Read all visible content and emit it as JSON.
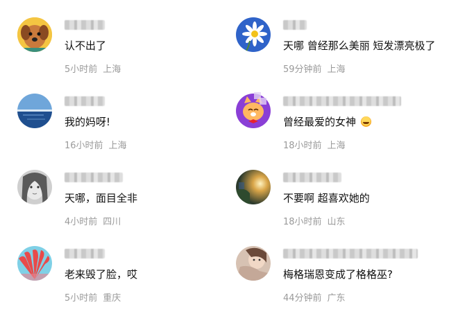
{
  "comments": [
    {
      "text": "认不出了",
      "time": "5小时前",
      "location": "上海",
      "avatar": "dog-avatar"
    },
    {
      "text": "天哪 曾经那么美丽 短发漂亮极了",
      "time": "59分钟前",
      "location": "上海",
      "avatar": "daisy-avatar"
    },
    {
      "text": "我的妈呀!",
      "time": "16小时前",
      "location": "上海",
      "avatar": "sea-avatar"
    },
    {
      "text": "曾经最爱的女神",
      "time": "18小时前",
      "location": "上海",
      "avatar": "cat-avatar",
      "emoji": "laughing-emoji"
    },
    {
      "text": "天哪，面目全非",
      "time": "4小时前",
      "location": "四川",
      "avatar": "sketch-girl-avatar"
    },
    {
      "text": "不要啊 超喜欢她的",
      "time": "18小时前",
      "location": "山东",
      "avatar": "sunset-avatar"
    },
    {
      "text": "老来毁了脸，哎",
      "time": "5小时前",
      "location": "重庆",
      "avatar": "red-fan-avatar"
    },
    {
      "text": "梅格瑞恩变成了格格巫?",
      "time": "44分钟前",
      "location": "广东",
      "avatar": "girl-photo-avatar"
    }
  ]
}
